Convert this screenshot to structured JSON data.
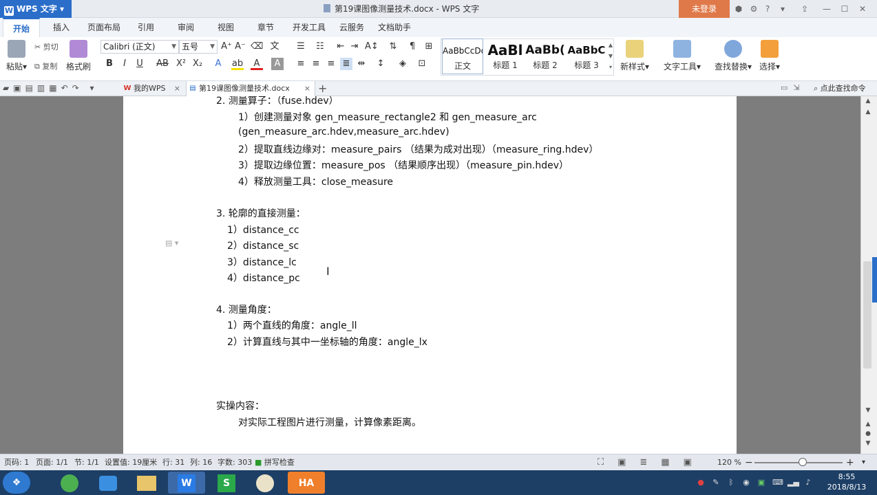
{
  "titlebar": {
    "app_name": "WPS 文字",
    "app_logo": "W",
    "doc_title": "第19课图像测量技术.docx - WPS 文字",
    "login": "未登录",
    "icons": [
      "shield-icon",
      "gear-icon",
      "help-icon",
      "skin-icon",
      "restore-icon",
      "minimize-icon",
      "maximize-icon",
      "close-icon"
    ]
  },
  "tabs": [
    "开始",
    "插入",
    "页面布局",
    "引用",
    "审阅",
    "视图",
    "章节",
    "开发工具",
    "云服务",
    "文档助手"
  ],
  "ribbon": {
    "paste": "粘贴",
    "cut": "剪切",
    "copy": "复制",
    "format_painter": "格式刷",
    "font_name": "Calibri (正文)",
    "font_size": "五号",
    "styles": [
      {
        "sample": "AaBbCcDd",
        "name": "正文"
      },
      {
        "sample": "AaBl",
        "name": "标题 1"
      },
      {
        "sample": "AaBb(",
        "name": "标题 2"
      },
      {
        "sample": "AaBbC",
        "name": "标题 3"
      }
    ],
    "new_style": "新样式",
    "text_tools": "文字工具",
    "find_replace": "查找替换",
    "select": "选择"
  },
  "doctabs": {
    "my_wps": "我的WPS",
    "doc": "第19课图像测量技术.docx",
    "search_cmd": "点此查找命令"
  },
  "document": {
    "l1": "2. 测量算子：（fuse.hdev）",
    "l2a": "1）创建测量对象 gen_measure_rectangle2 和 gen_measure_arc",
    "l2b": "(gen_measure_arc.hdev,measure_arc.hdev)",
    "l3": "2）提取直线边缘对：measure_pairs （结果为成对出现）（measure_ring.hdev）",
    "l4": "3）提取边缘位置：measure_pos （结果顺序出现）（measure_pin.hdev）",
    "l5": "4）释放测量工具：close_measure",
    "s3": "3. 轮廓的直接测量：",
    "s3_1": "1）distance_cc",
    "s3_2": "2）distance_sc",
    "s3_3": "3）distance_lc",
    "s3_4": "4）distance_pc",
    "s4": "4. 测量角度：",
    "s4_1": "1）两个直线的角度：angle_ll",
    "s4_2": "2）计算直线与其中一坐标轴的角度：angle_lx",
    "s5": "实操内容：",
    "s5_1": "对实际工程图片进行测量，计算像素距离。"
  },
  "status": {
    "page": "页码: 1",
    "pages": "页面: 1/1",
    "section": "节: 1/1",
    "setting": "设置值: 19厘米",
    "row": "行: 31",
    "col": "列: 16",
    "words": "字数: 303",
    "spell": "拼写检查",
    "zoom": "120 %",
    "zoom_fraction": 0.55
  },
  "taskbar": {
    "apps": [
      "chrome-icon",
      "camera-icon",
      "folder-icon",
      "wps-writer-icon",
      "wps-sheet-icon",
      "paint-icon",
      "halcon-icon"
    ],
    "halcon_label": "HA",
    "time": "8:55",
    "date": "2018/8/13"
  },
  "colors": {
    "accent": "#2b6ec9",
    "login": "#e0794a",
    "taskbar": "#1d3f66"
  }
}
